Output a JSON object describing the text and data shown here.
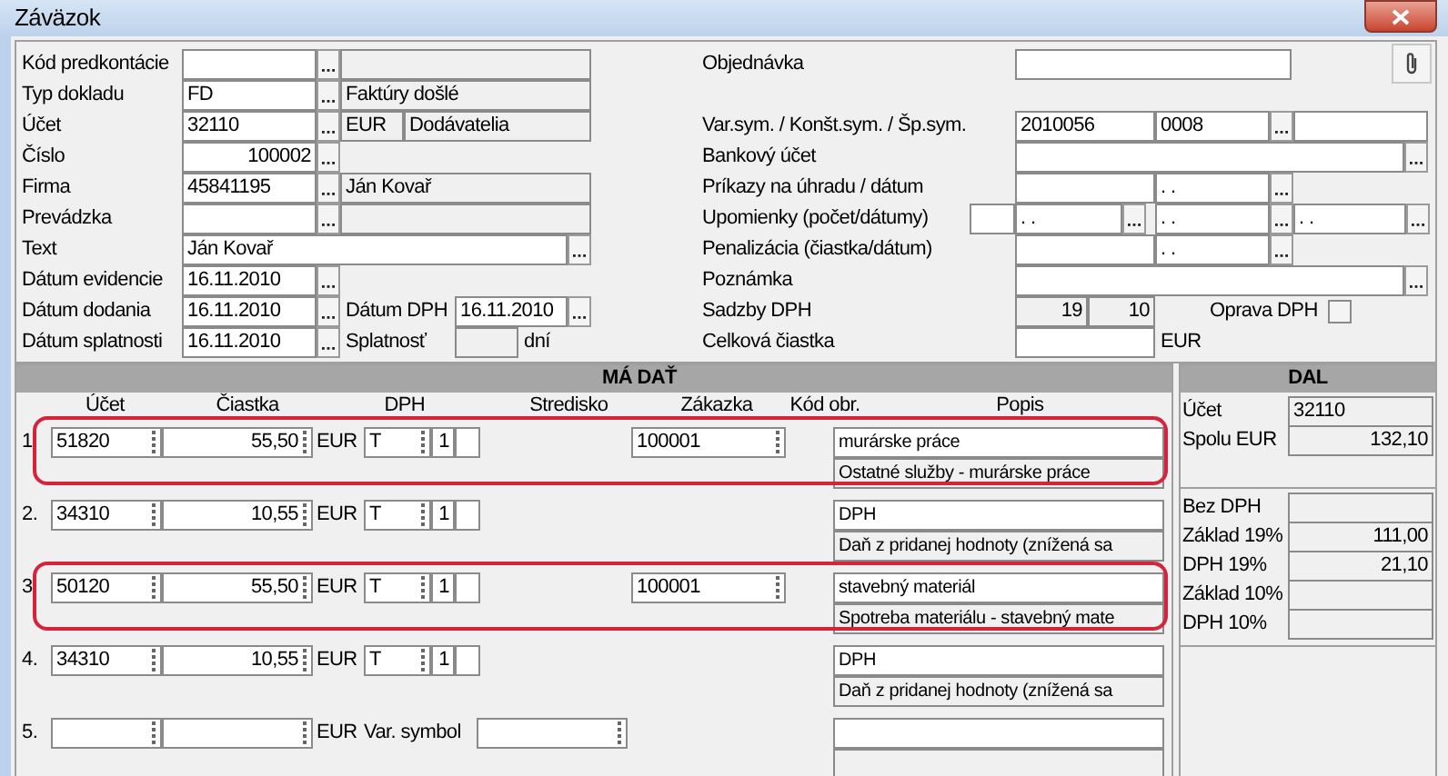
{
  "window": {
    "title": "Záväzok"
  },
  "header_left": [
    {
      "kind": "lookup_described",
      "label": "Kód predkontácie"
    },
    {
      "kind": "lookup_described",
      "label": "Typ dokladu",
      "value": "FD",
      "description": "Faktúry došlé"
    },
    {
      "kind": "lookup_currency",
      "label": "Účet",
      "value": "32110",
      "currency": "EUR",
      "description": "Dodávatelia"
    },
    {
      "kind": "number",
      "label": "Číslo",
      "value": "100002"
    },
    {
      "kind": "lookup_described",
      "label": "Firma",
      "value": "45841195",
      "description": "Ján Kovař"
    },
    {
      "kind": "lookup_described",
      "label": "Prevádzka"
    },
    {
      "kind": "text",
      "label": "Text",
      "value": "Ján Kovař"
    },
    {
      "kind": "date",
      "label": "Dátum evidencie",
      "value": "16.11.2010"
    },
    {
      "kind": "date_pair",
      "label": "Dátum dodania",
      "value": "16.11.2010",
      "second_label": "Dátum DPH",
      "second_value": "16.11.2010"
    },
    {
      "kind": "date_due",
      "label": "Dátum splatnosti",
      "value": "16.11.2010",
      "second_label": "Splatnosť",
      "unit": "dní"
    }
  ],
  "header_right": [
    {
      "kind": "order",
      "label": "Objednávka"
    },
    {
      "kind": "symbols",
      "label": "Var.sym. / Konšt.sym. / Šp.sym.",
      "values": [
        "2010056",
        "0008"
      ]
    },
    {
      "kind": "wide",
      "label": "Bankový účet"
    },
    {
      "kind": "amount_date",
      "label": "Príkazy na úhradu / dátum",
      "date": ". ."
    },
    {
      "kind": "reminders",
      "label": "Upomienky (počet/dátumy)",
      "dates": [
        ". .",
        ". .",
        ". ."
      ]
    },
    {
      "kind": "amount_date",
      "label": "Penalizácia (čiastka/dátum)",
      "date": ". ."
    },
    {
      "kind": "wide",
      "label": "Poznámka"
    },
    {
      "kind": "rates",
      "label": "Sadzby DPH",
      "rates": [
        "19",
        "10"
      ],
      "correction": {
        "label": "Oprava DPH",
        "checked": false
      }
    },
    {
      "kind": "total",
      "label": "Celková čiastka",
      "unit": "EUR"
    }
  ],
  "debit": {
    "title": "MÁ DAŤ",
    "columns": [
      "Účet",
      "Čiastka",
      "DPH",
      "Stredisko",
      "Zákazka",
      "Kód obr.",
      "Popis"
    ],
    "lines": [
      {
        "kind": "entry",
        "number": "1.",
        "account": "51820",
        "amount": "55,50",
        "currency": "EUR",
        "vat_code": "T",
        "vat_rate": "1",
        "order": "100001",
        "description": "murárske práce",
        "account_name": "Ostatné služby - murárske práce",
        "highlighted": true
      },
      {
        "kind": "entry",
        "number": "2.",
        "account": "34310",
        "amount": "10,55",
        "currency": "EUR",
        "vat_code": "T",
        "vat_rate": "1",
        "description": "DPH",
        "account_name": "Daň z pridanej hodnoty (znížená sa",
        "highlighted": false
      },
      {
        "kind": "entry",
        "number": "3.",
        "account": "50120",
        "amount": "55,50",
        "currency": "EUR",
        "vat_code": "T",
        "vat_rate": "1",
        "order": "100001",
        "description": "stavebný materiál",
        "account_name": "Spotreba materiálu - stavebný mate",
        "highlighted": true
      },
      {
        "kind": "entry",
        "number": "4.",
        "account": "34310",
        "amount": "10,55",
        "currency": "EUR",
        "vat_code": "T",
        "vat_rate": "1",
        "description": "DPH",
        "account_name": "Daň z pridanej hodnoty (znížená sa",
        "highlighted": false
      },
      {
        "kind": "open",
        "number": "5.",
        "currency": "EUR",
        "symbol_label": "Var. symbol",
        "highlighted": false
      }
    ]
  },
  "credit": {
    "title": "DAL",
    "account_label": "Účet",
    "account": "32110",
    "total_label": "Spolu EUR",
    "total": "132,10",
    "summary": [
      {
        "label": "Bez DPH"
      },
      {
        "label": "Základ 19%",
        "value": "111,00"
      },
      {
        "label": "DPH 19%",
        "value": "21,10"
      },
      {
        "label": "Základ 10%"
      },
      {
        "label": "DPH 10%"
      }
    ]
  }
}
